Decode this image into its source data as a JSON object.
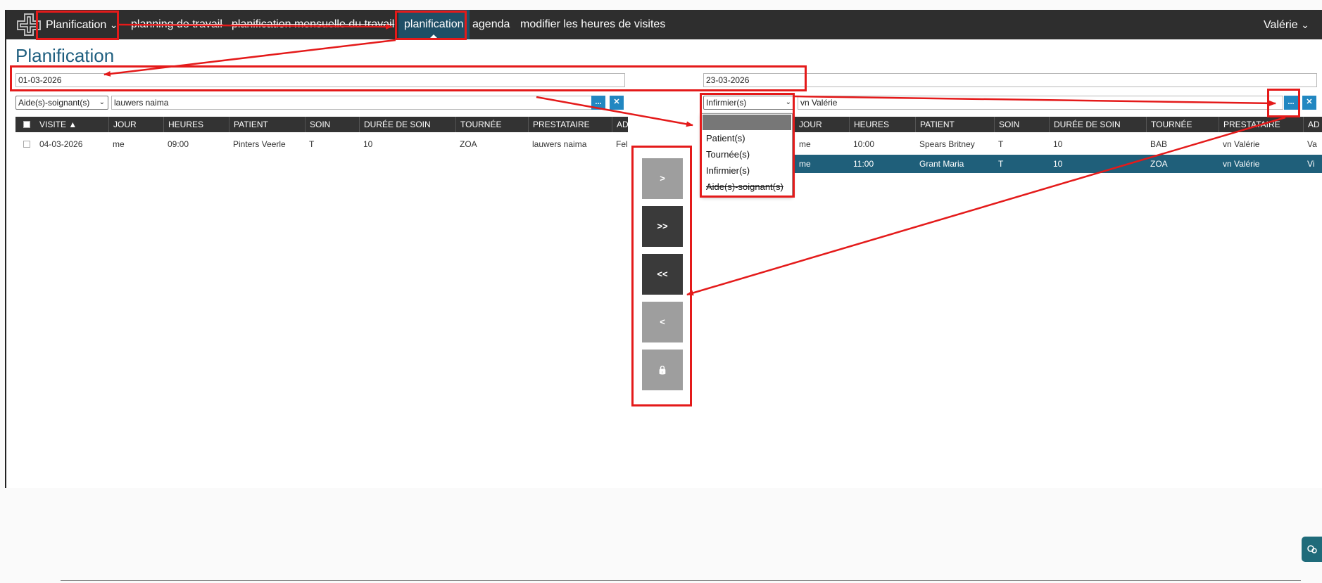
{
  "nav": {
    "planification_dropdown": "Planification",
    "chevron": "⌄",
    "planning_travail": "planning de travail",
    "planification_mensuelle": "planification mensuelle du travail",
    "planification": "planification",
    "agenda": "agenda",
    "modifier_heures": "modifier les heures de visites",
    "user": "Valérie"
  },
  "page_title": "Planification",
  "left": {
    "date": "01-03-2026",
    "filter_type": "Aide(s)-soignant(s)",
    "filter_value": "lauwers naima",
    "more_label": "...",
    "clear_label": "✕",
    "columns": [
      "VISITE ▲",
      "JOUR",
      "HEURES",
      "PATIENT",
      "SOIN",
      "DURÉE DE SOIN",
      "TOURNÉE",
      "PRESTATAIRE",
      "AD"
    ],
    "rows": [
      [
        "04-03-2026",
        "me",
        "09:00",
        "Pinters Veerle",
        "T",
        "10",
        "ZOA",
        "lauwers naima",
        "Fel"
      ]
    ]
  },
  "right": {
    "date": "23-03-2026",
    "filter_type": "Infirmier(s)",
    "filter_value": "vn Valérie",
    "more_label": "...",
    "clear_label": "✕",
    "columns": [
      "JOUR",
      "HEURES",
      "PATIENT",
      "SOIN",
      "DURÉE DE SOIN",
      "TOURNÉE",
      "PRESTATAIRE",
      "AD"
    ],
    "rows": [
      [
        "me",
        "10:00",
        "Spears Britney",
        "T",
        "10",
        "BAB",
        "vn Valérie",
        "Va"
      ],
      [
        "me",
        "11:00",
        "Grant Maria",
        "T",
        "10",
        "ZOA",
        "vn Valérie",
        "Vi"
      ]
    ],
    "dropdown_options": [
      "Patient(s)",
      "Tournée(s)",
      "Infirmier(s)",
      "Aide(s)-soignant(s)"
    ]
  },
  "actions": {
    "move_right": ">",
    "move_all_right": ">>",
    "move_all_left": "<<",
    "move_left": "<",
    "lock_icon": "🔒"
  },
  "chat_icon": "chat-icon",
  "colors": {
    "topbar": "#2e2e2e",
    "active_nav": "#1f4f66",
    "title": "#1f5f80",
    "selected_row": "#1f5f7a",
    "annotation": "#e41a1a",
    "button_blue": "#2287c1"
  }
}
